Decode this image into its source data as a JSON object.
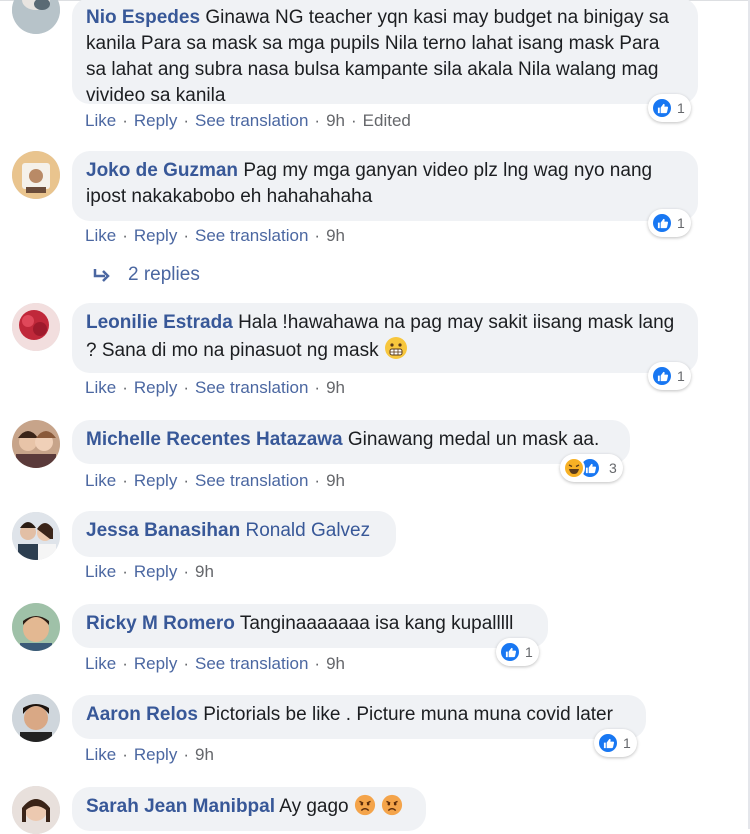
{
  "actions": {
    "like": "Like",
    "reply": "Reply",
    "translate": "See translation",
    "dot": "·"
  },
  "comments": [
    {
      "author": "Nio Espedes",
      "text": "Ginawa NG teacher yqn kasi may budget na binigay sa kanila Para sa mask sa mga pupils Nila terno lahat isang mask Para sa lahat ang subra nasa bulsa kampante sila akala Nila walang mag vivideo sa kanila",
      "time": "9h",
      "edited": "Edited",
      "reactions": "1"
    },
    {
      "author": "Joko de Guzman",
      "text": "Pag my mga ganyan video plz lng wag nyo nang ipost nakakabobo eh hahahahaha",
      "time": "9h",
      "reactions": "1"
    },
    {
      "author": "Leonilie Estrada",
      "text": "Hala !hawahawa na pag may sakit iisang mask lang ? Sana di mo na pinasuot ng mask",
      "time": "9h",
      "reactions": "1"
    },
    {
      "author": "Michelle Recentes Hatazawa",
      "text": "Ginawang medal un mask aa.",
      "time": "9h",
      "reactions": "3"
    },
    {
      "author": "Jessa Banasihan",
      "text": "Ronald Galvez",
      "time": "9h"
    },
    {
      "author": "Ricky M Romero",
      "text": "Tanginaaaaaaa isa kang kupalllll",
      "time": "9h",
      "reactions": "1"
    },
    {
      "author": "Aaron Relos",
      "text": "Pictorials be like . Picture muna muna covid later",
      "time": "9h",
      "reactions": "1"
    },
    {
      "author": "Sarah Jean Manibpal",
      "text": "Ay gago"
    }
  ],
  "replies_link": "2 replies",
  "colors": {
    "author": "#385898",
    "link": "#4b67a1",
    "bubble": "#f0f2f5",
    "like": "#1877f2",
    "haha": "#f7b125"
  }
}
